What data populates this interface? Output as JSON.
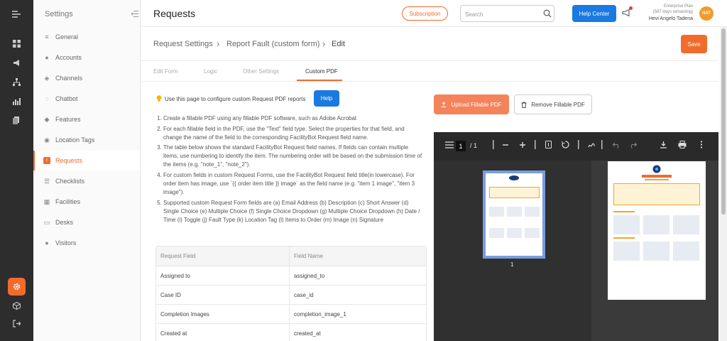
{
  "sidebar": {
    "title": "Settings",
    "items": [
      {
        "label": "General",
        "icon": "sliders-icon"
      },
      {
        "label": "Accounts",
        "icon": "users-icon"
      },
      {
        "label": "Channels",
        "icon": "link-icon"
      },
      {
        "label": "Chatbot",
        "icon": "chat-icon"
      },
      {
        "label": "Features",
        "icon": "feature-icon"
      },
      {
        "label": "Location Tags",
        "icon": "location-icon"
      },
      {
        "label": "Requests",
        "icon": "request-icon"
      },
      {
        "label": "Checklists",
        "icon": "checklist-icon"
      },
      {
        "label": "Facilities",
        "icon": "facility-icon"
      },
      {
        "label": "Desks",
        "icon": "desk-icon"
      },
      {
        "label": "Visitors",
        "icon": "visitor-icon"
      }
    ],
    "active_item": "Requests"
  },
  "header": {
    "title": "Requests",
    "subscription_label": "Subscription",
    "search_placeholder": "Search",
    "help_center_label": "Help Center",
    "plan_name": "Enterprise Plan",
    "plan_days": "(587 days remaining)",
    "user_name": "Hevi Angelo Tadena",
    "avatar_initials": "HAT"
  },
  "breadcrumb": {
    "items": [
      "Request Settings",
      "Report Fault (custom form)",
      "Edit"
    ],
    "save_label": "Save"
  },
  "tabs": {
    "items": [
      "Edit Form",
      "Logic",
      "Other Settings",
      "Custom PDF"
    ],
    "active": "Custom PDF"
  },
  "content": {
    "info_text": "Use this page to configure custom Request PDF reports",
    "help_label": "Help",
    "instructions": [
      "Create a fillable PDF using any fillable PDF software, such as Adobe Acrobat",
      "For each fillable field in the PDF, use the \"Text\" field type. Select the properties for that field, and change the name of the field to the corresponding FacilityBot Request field name.",
      "The table below shows the standard FacilityBot Request field names. If fields can contain multiple items, use numbering to identify the item. The numbering order will be based on the submission time of the items (e.g. \"note_1\", \"note_2\").",
      "For custom fields in custom Request Forms, use the FacilityBot Request field title(in lowercase). For order item has image, use `{{ order item title }} image` as the field name (e.g. \"item 1 image\", \"item 3 image\").",
      "Supported custom Request Form fields are (a) Email Address (b) Description (c) Short Answer (d) Single Choice (e) Multiple Choice (f) Single Choice Dropdown (g) Multiple Choice Dropdown (h) Date / Time (i) Toggle (j) Fault Type (k) Location Tag (l) Items to Order (m) Image (n) Signature"
    ],
    "table": {
      "headers": [
        "Request Field",
        "Field Name"
      ],
      "rows": [
        [
          "Assigned to",
          "assigned_to"
        ],
        [
          "Case ID",
          "case_id"
        ],
        [
          "Completion Images",
          "completion_image_1"
        ],
        [
          "Created at",
          "created_at"
        ]
      ]
    }
  },
  "pdf_panel": {
    "upload_label": "Upload Fillable PDF",
    "remove_label": "Remove Fillable PDF",
    "current_page": "1",
    "total_pages": "/ 1",
    "thumbnail_label": "1"
  },
  "colors": {
    "accent": "#f26b2d",
    "primary_blue": "#1a7ae0",
    "rail_bg": "#2d2d2d"
  }
}
